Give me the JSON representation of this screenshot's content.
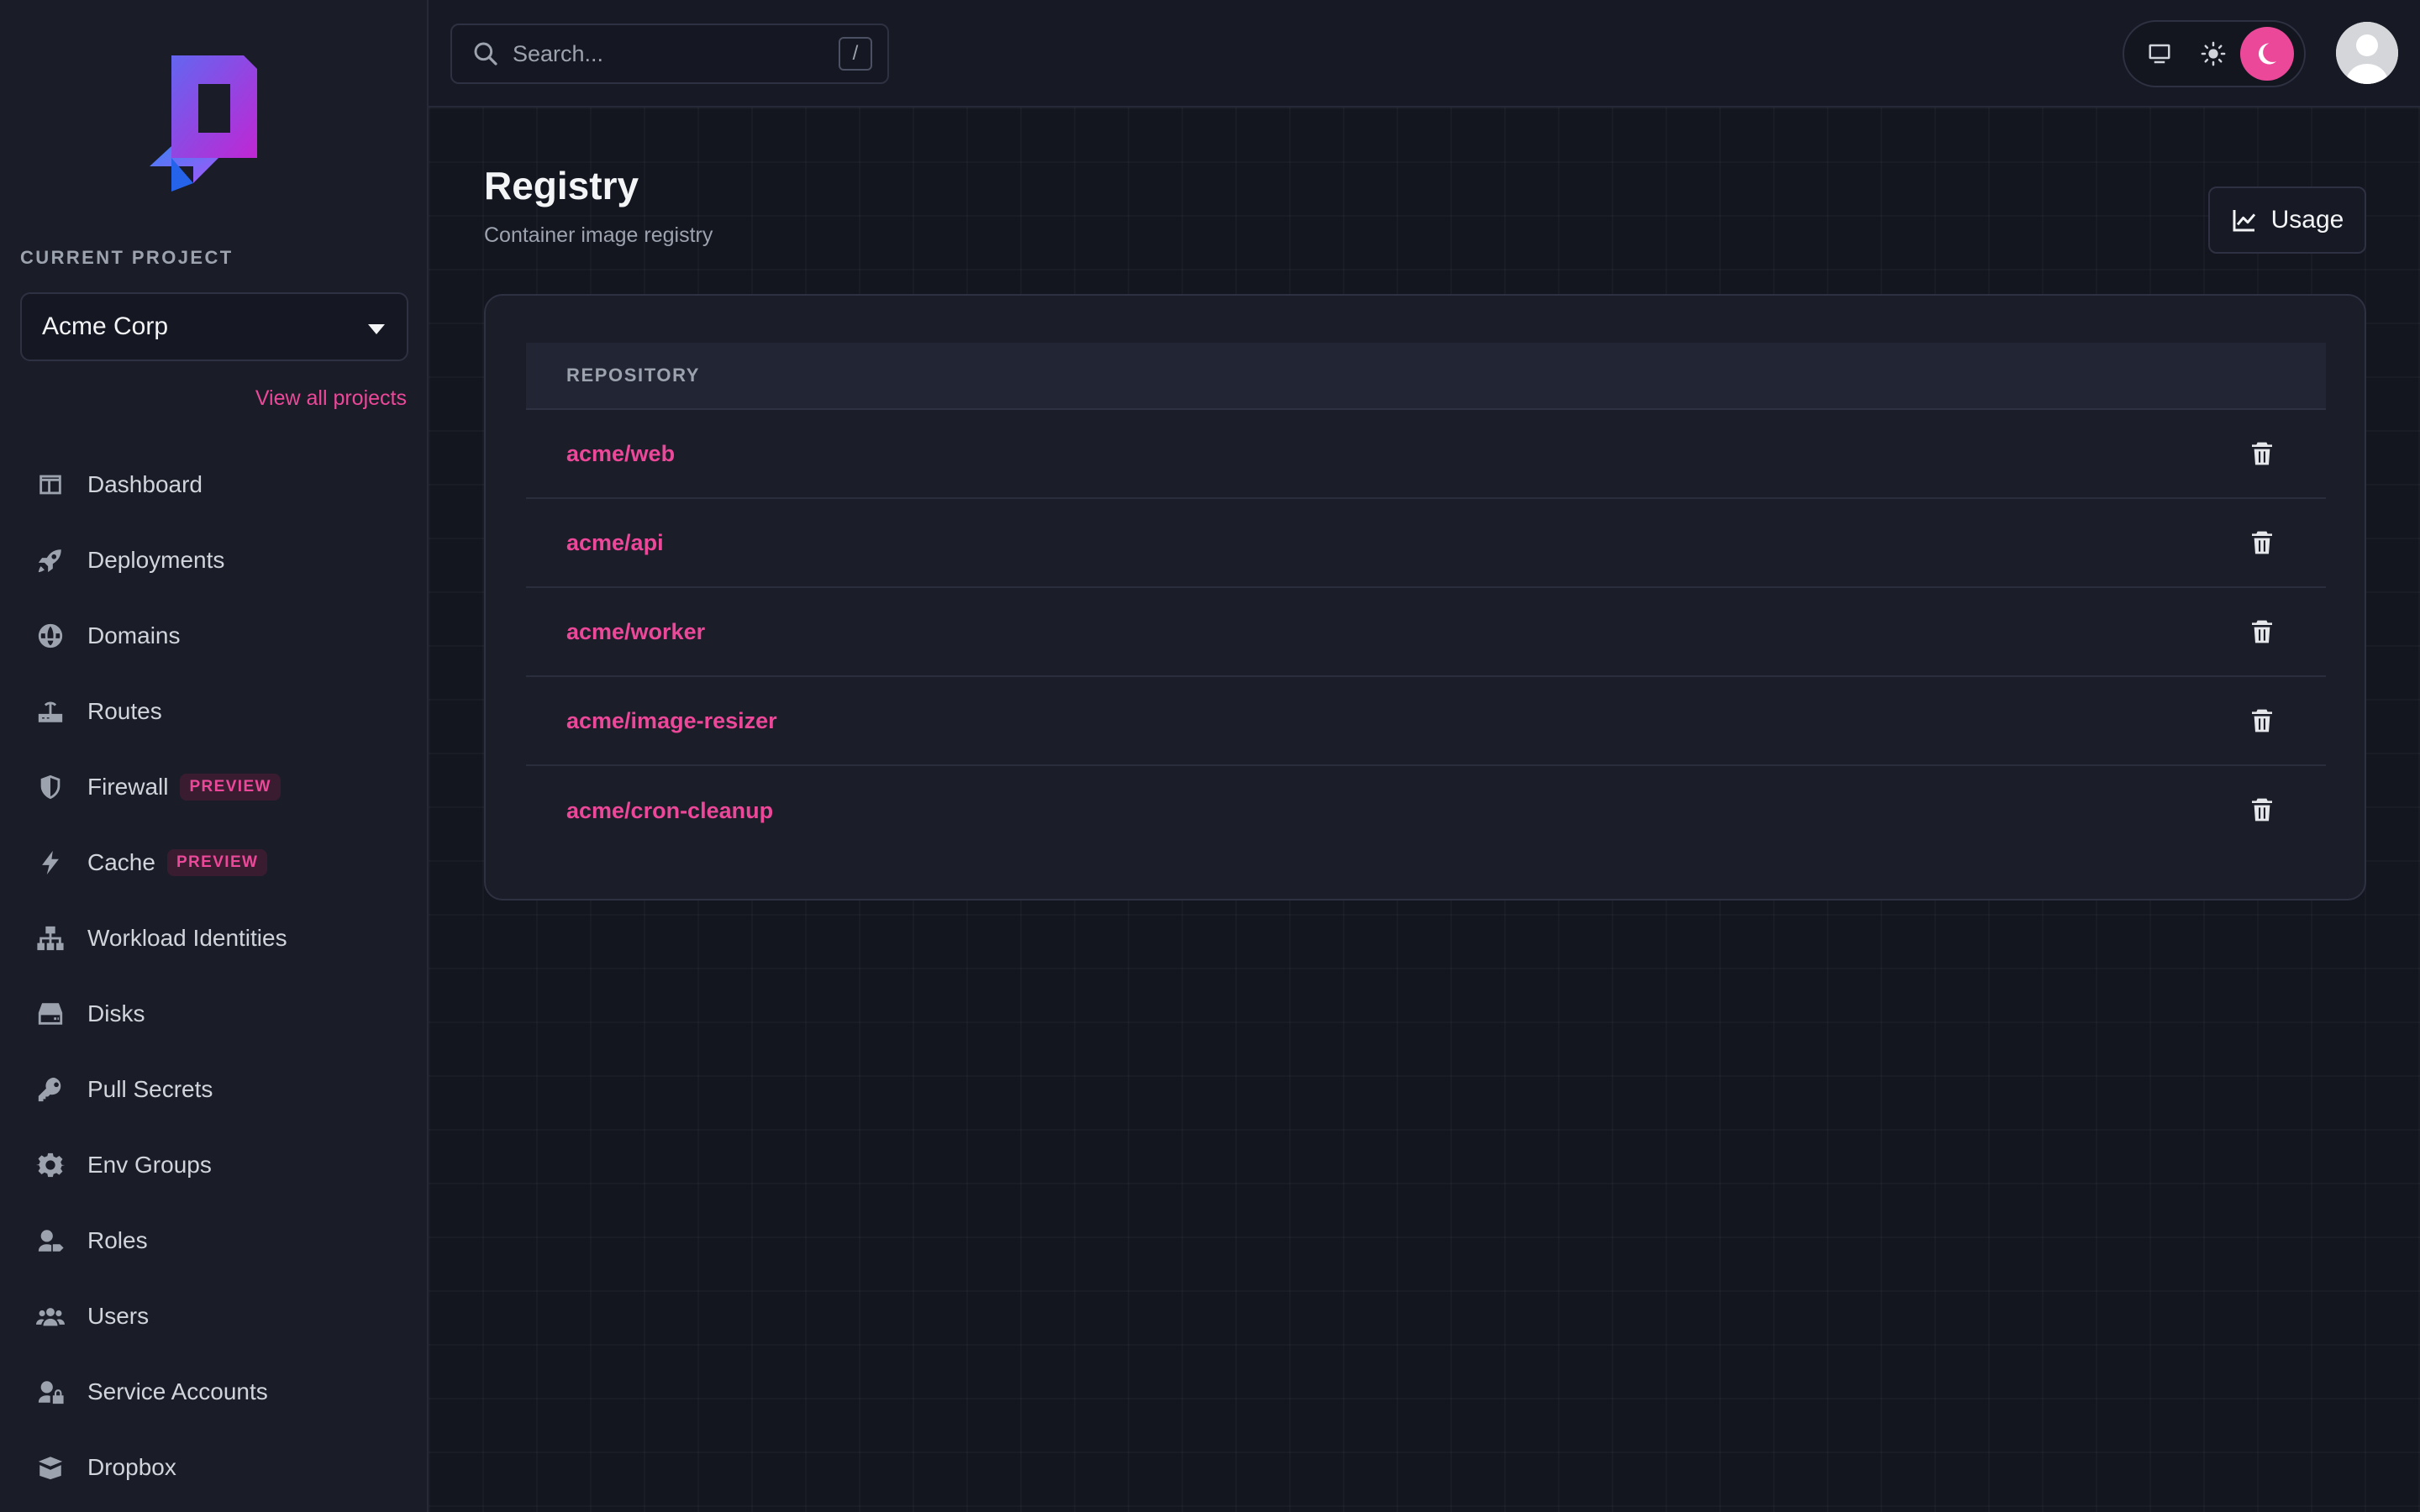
{
  "sidebar": {
    "project_label": "CURRENT PROJECT",
    "project_value": "Acme Corp",
    "view_all": "View all projects",
    "items": [
      {
        "label": "Dashboard",
        "icon": "dashboard-icon"
      },
      {
        "label": "Deployments",
        "icon": "rocket-icon"
      },
      {
        "label": "Domains",
        "icon": "globe-icon"
      },
      {
        "label": "Routes",
        "icon": "router-icon"
      },
      {
        "label": "Firewall",
        "icon": "shield-icon",
        "badge": "PREVIEW"
      },
      {
        "label": "Cache",
        "icon": "bolt-icon",
        "badge": "PREVIEW"
      },
      {
        "label": "Workload Identities",
        "icon": "network-icon"
      },
      {
        "label": "Disks",
        "icon": "disk-icon"
      },
      {
        "label": "Pull Secrets",
        "icon": "key-icon"
      },
      {
        "label": "Env Groups",
        "icon": "gear-icon"
      },
      {
        "label": "Roles",
        "icon": "user-tag-icon"
      },
      {
        "label": "Users",
        "icon": "users-icon"
      },
      {
        "label": "Service Accounts",
        "icon": "user-lock-icon"
      },
      {
        "label": "Dropbox",
        "icon": "box-open-icon"
      }
    ]
  },
  "topbar": {
    "search_placeholder": "Search...",
    "search_shortcut": "/",
    "theme_options": [
      "monitor-icon",
      "sun-icon",
      "moon-icon"
    ],
    "theme_active": "moon-icon"
  },
  "main": {
    "title": "Registry",
    "subtitle": "Container image registry",
    "usage_label": "Usage",
    "table": {
      "header": "REPOSITORY",
      "rows": [
        "acme/web",
        "acme/api",
        "acme/worker",
        "acme/image-resizer",
        "acme/cron-cleanup"
      ]
    }
  },
  "colors": {
    "accent": "#ec4899",
    "background": "#13151f",
    "sidebar": "#1a1c28",
    "card": "#1b1d29"
  }
}
